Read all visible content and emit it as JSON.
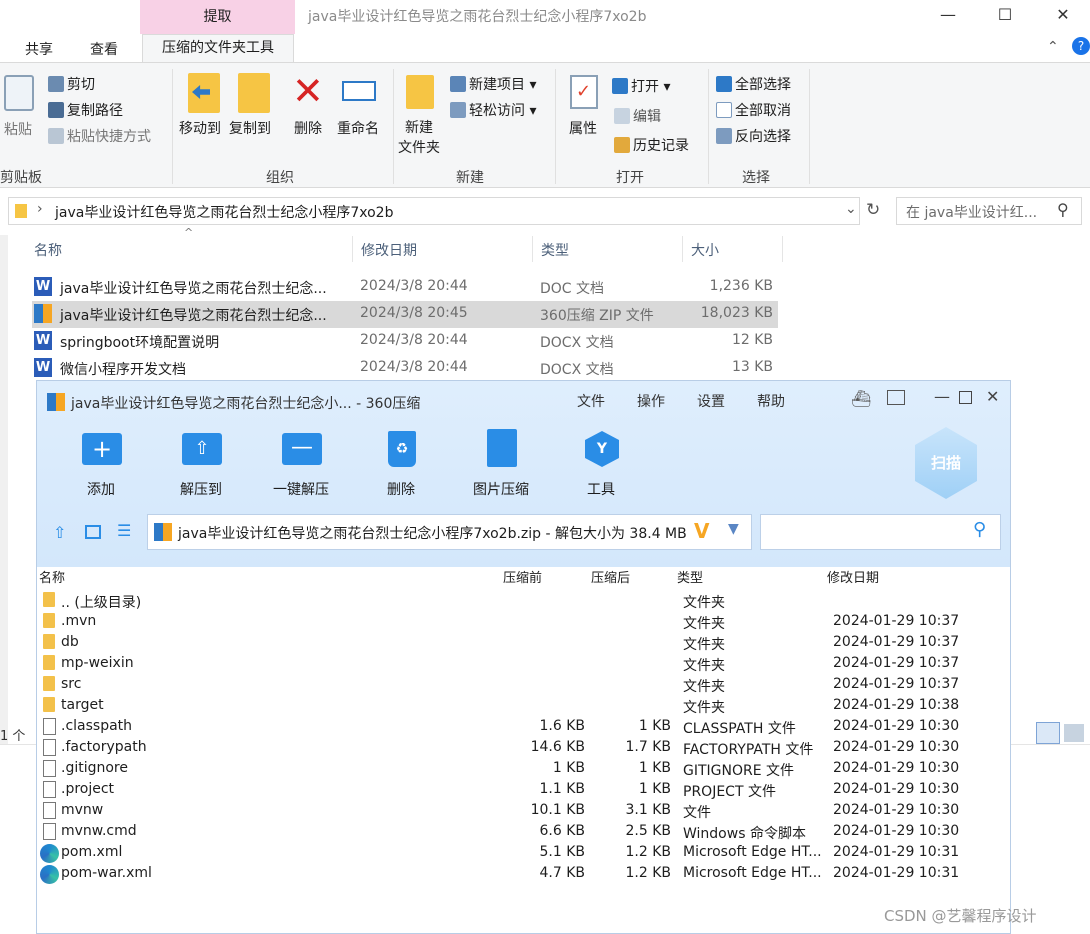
{
  "explorer": {
    "context_tab": "提取",
    "window_title": "java毕业设计红色导览之雨花台烈士纪念小程序7xo2b",
    "ribbon_tabs": [
      "共享",
      "查看",
      "压缩的文件夹工具"
    ],
    "clipboard": {
      "paste": "粘贴",
      "cut": "剪切",
      "copy_path": "复制路径",
      "paste_shortcut": "粘贴快捷方式",
      "group": "剪贴板"
    },
    "organize": {
      "move_to": "移动到",
      "copy_to": "复制到",
      "delete": "删除",
      "rename": "重命名",
      "group": "组织"
    },
    "new": {
      "new_folder": "新建\n文件夹",
      "new_folder_1": "新建",
      "new_folder_2": "文件夹",
      "new_item": "新建项目",
      "easy_access": "轻松访问",
      "group": "新建"
    },
    "open": {
      "properties": "属性",
      "open": "打开",
      "edit": "编辑",
      "history": "历史记录",
      "group": "打开"
    },
    "select": {
      "select_all": "全部选择",
      "select_none": "全部取消",
      "invert": "反向选择",
      "group": "选择"
    },
    "address": "java毕业设计红色导览之雨花台烈士纪念小程序7xo2b",
    "search_placeholder": "在 java毕业设计红...",
    "columns": [
      "名称",
      "修改日期",
      "类型",
      "大小"
    ],
    "files": [
      {
        "name": "java毕业设计红色导览之雨花台烈士纪念...",
        "date": "2024/3/8 20:44",
        "type": "DOC 文档",
        "size": "1,236 KB"
      },
      {
        "name": "java毕业设计红色导览之雨花台烈士纪念...",
        "date": "2024/3/8 20:45",
        "type": "360压缩 ZIP 文件",
        "size": "18,023 KB"
      },
      {
        "name": "springboot环境配置说明",
        "date": "2024/3/8 20:44",
        "type": "DOCX 文档",
        "size": "12 KB"
      },
      {
        "name": "微信小程序开发文档",
        "date": "2024/3/8 20:44",
        "type": "DOCX 文档",
        "size": "13 KB"
      }
    ],
    "status": "1 个"
  },
  "zip360": {
    "title": "java毕业设计红色导览之雨花台烈士纪念小... - 360压缩",
    "menu": [
      "文件",
      "操作",
      "设置",
      "帮助"
    ],
    "tools": [
      "添加",
      "解压到",
      "一键解压",
      "删除",
      "图片压缩",
      "工具"
    ],
    "scan": "扫描",
    "path": "java毕业设计红色导览之雨花台烈士纪念小程序7xo2b.zip - 解包大小为 38.4 MB",
    "columns": [
      "名称",
      "压缩前",
      "压缩后",
      "类型",
      "修改日期"
    ],
    "rows": [
      {
        "name": ".. (上级目录)",
        "before": "",
        "after": "",
        "type": "文件夹",
        "date": "",
        "icon": "folder"
      },
      {
        "name": ".mvn",
        "before": "",
        "after": "",
        "type": "文件夹",
        "date": "2024-01-29 10:37",
        "icon": "folder"
      },
      {
        "name": "db",
        "before": "",
        "after": "",
        "type": "文件夹",
        "date": "2024-01-29 10:37",
        "icon": "folder"
      },
      {
        "name": "mp-weixin",
        "before": "",
        "after": "",
        "type": "文件夹",
        "date": "2024-01-29 10:37",
        "icon": "folder"
      },
      {
        "name": "src",
        "before": "",
        "after": "",
        "type": "文件夹",
        "date": "2024-01-29 10:37",
        "icon": "folder"
      },
      {
        "name": "target",
        "before": "",
        "after": "",
        "type": "文件夹",
        "date": "2024-01-29 10:38",
        "icon": "folder"
      },
      {
        "name": ".classpath",
        "before": "1.6 KB",
        "after": "1 KB",
        "type": "CLASSPATH 文件",
        "date": "2024-01-29 10:30",
        "icon": "file"
      },
      {
        "name": ".factorypath",
        "before": "14.6 KB",
        "after": "1.7 KB",
        "type": "FACTORYPATH 文件",
        "date": "2024-01-29 10:30",
        "icon": "file"
      },
      {
        "name": ".gitignore",
        "before": "1 KB",
        "after": "1 KB",
        "type": "GITIGNORE 文件",
        "date": "2024-01-29 10:30",
        "icon": "file"
      },
      {
        "name": ".project",
        "before": "1.1 KB",
        "after": "1 KB",
        "type": "PROJECT 文件",
        "date": "2024-01-29 10:30",
        "icon": "file"
      },
      {
        "name": "mvnw",
        "before": "10.1 KB",
        "after": "3.1 KB",
        "type": "文件",
        "date": "2024-01-29 10:30",
        "icon": "file"
      },
      {
        "name": "mvnw.cmd",
        "before": "6.6 KB",
        "after": "2.5 KB",
        "type": "Windows 命令脚本",
        "date": "2024-01-29 10:30",
        "icon": "file"
      },
      {
        "name": "pom.xml",
        "before": "5.1 KB",
        "after": "1.2 KB",
        "type": "Microsoft Edge HT...",
        "date": "2024-01-29 10:31",
        "icon": "edge"
      },
      {
        "name": "pom-war.xml",
        "before": "4.7 KB",
        "after": "1.2 KB",
        "type": "Microsoft Edge HT...",
        "date": "2024-01-29 10:31",
        "icon": "edge"
      }
    ]
  },
  "watermark": "CSDN @艺馨程序设计"
}
